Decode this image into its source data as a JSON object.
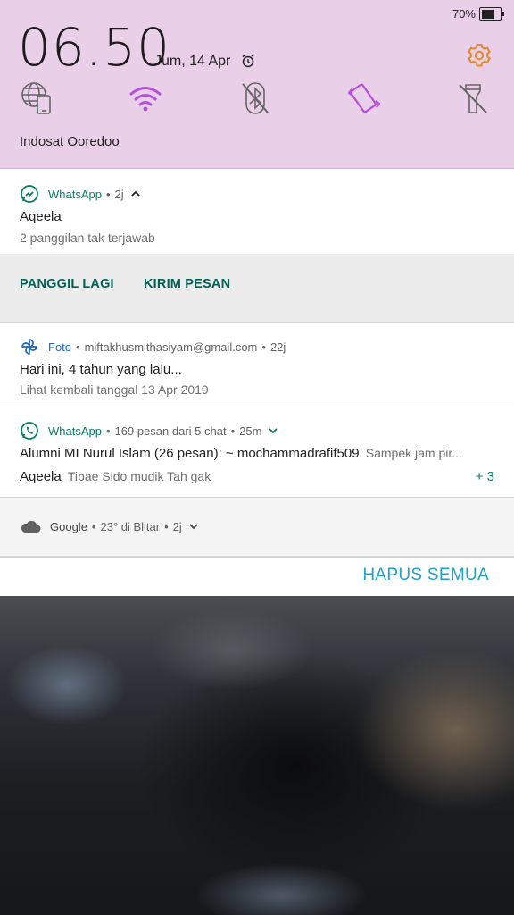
{
  "status_bar": {
    "battery_percent": "70%",
    "battery_level": 0.7
  },
  "quick_settings": {
    "time": "06.50",
    "date": "Jum, 14 Apr",
    "operator": "Indosat Ooredoo",
    "tiles": [
      {
        "name": "mobile-data",
        "icon": "globe-phone-icon",
        "active": false
      },
      {
        "name": "wifi",
        "icon": "wifi-icon",
        "active": true
      },
      {
        "name": "bluetooth",
        "icon": "bluetooth-off-icon",
        "active": false
      },
      {
        "name": "vibrate",
        "icon": "vibrate-icon",
        "active": true
      },
      {
        "name": "flashlight",
        "icon": "flashlight-off-icon",
        "active": false
      }
    ],
    "colors": {
      "background": "#e9cfe7",
      "active_tile": "#b64fe0",
      "settings_icon": "#e08a2c"
    }
  },
  "notifications": [
    {
      "app": "WhatsApp",
      "age": "2j",
      "title": "Aqeela",
      "text": "2 panggilan tak terjawab",
      "actions": [
        "PANGGIL LAGI",
        "KIRIM PESAN"
      ]
    },
    {
      "app": "Foto",
      "account": "miftakhusmithasiyam@gmail.com",
      "age": "22j",
      "title": "Hari ini, 4 tahun yang lalu...",
      "text": "Lihat kembali tanggal 13 Apr 2019"
    },
    {
      "app": "WhatsApp",
      "summary": "169 pesan dari 5 chat",
      "age": "25m",
      "line1_sender": "Alumni MI Nurul Islam (26 pesan): ~ mochammadrafif509",
      "line1_text": "Sampek jam pir...",
      "line2_sender": "Aqeela",
      "line2_text": "Tibae Sido mudik Tah gak",
      "more": "+ 3"
    },
    {
      "app": "Google",
      "weather": "23° di Blitar",
      "age": "2j"
    }
  ],
  "clear_all_label": "HAPUS SEMUA",
  "colors": {
    "whatsapp_green": "#0a7c66",
    "action_text": "#006055",
    "clear_all": "#1ea3c7"
  }
}
